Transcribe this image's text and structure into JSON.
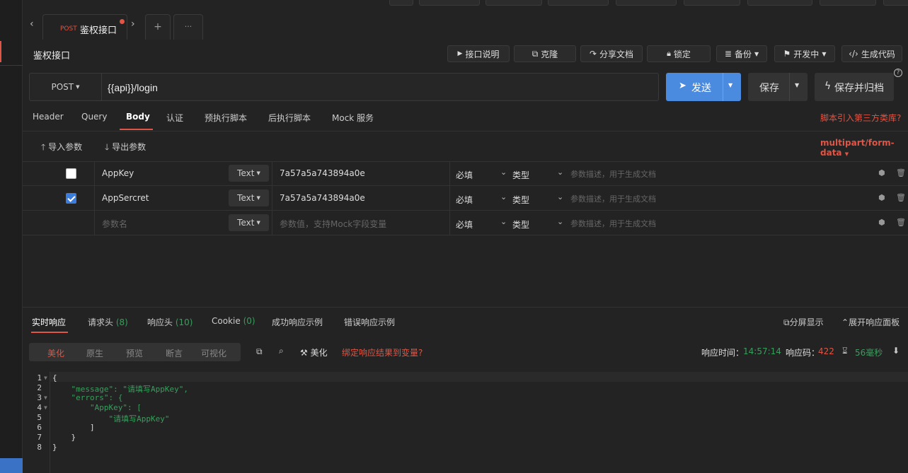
{
  "tab": {
    "method": "POST",
    "title": "鉴权接口",
    "add_label": "+",
    "more_label": "···"
  },
  "page": {
    "title": "鉴权接口"
  },
  "toolbar": {
    "doc_label": "接口说明",
    "clone_label": "克隆",
    "share_label": "分享文档",
    "lock_label": "锁定",
    "backup_label": "备份",
    "status_label": "开发中",
    "codegen_label": "生成代码"
  },
  "request": {
    "method": "POST",
    "url": "{{api}}/login",
    "send_label": "发送",
    "save_label": "保存",
    "save_archive_label": "保存并归档"
  },
  "subtabs": [
    "Header",
    "Query",
    "Body",
    "认证",
    "预执行脚本",
    "后执行脚本",
    "Mock 服务"
  ],
  "script_link": "脚本引入第三方类库?",
  "body": {
    "import_label": "导入参数",
    "export_label": "导出参数",
    "content_type": "multipart/form-data",
    "rows": [
      {
        "checked": false,
        "name": "AppKey",
        "type": "Text",
        "value": "7a57a5a743894a0e",
        "required": "必填",
        "field_type": "类型",
        "desc": "参数描述，用于生成文档"
      },
      {
        "checked": true,
        "name": "AppSercret",
        "type": "Text",
        "value": "7a57a5a743894a0e",
        "required": "必填",
        "field_type": "类型",
        "desc": "参数描述，用于生成文档"
      }
    ],
    "new_row": {
      "name_placeholder": "参数名",
      "type": "Text",
      "value_placeholder": "参数值，支持Mock字段变量",
      "required": "必填",
      "field_type": "类型",
      "desc": "参数描述，用于生成文档"
    }
  },
  "response_tabs": {
    "realtime": "实时响应",
    "req_headers": "请求头",
    "req_headers_count": "(8)",
    "resp_headers": "响应头",
    "resp_headers_count": "(10)",
    "cookie": "Cookie",
    "cookie_count": "(0)",
    "success_example": "成功响应示例",
    "error_example": "错误响应示例",
    "split_label": "分屏显示",
    "expand_label": "展开响应面板"
  },
  "response_toolbar": {
    "formats": [
      "美化",
      "原生",
      "预览",
      "断言",
      "可视化"
    ],
    "beautify_label": "美化",
    "bind_label": "绑定响应结果到变量?",
    "time_label": "响应时间：",
    "time_value": "14:57:14",
    "code_label": "响应码：",
    "code_value": "422",
    "duration_value": "56毫秒"
  },
  "response_body": {
    "line_numbers": [
      "1",
      "2",
      "3",
      "4",
      "5",
      "6",
      "7",
      "8"
    ],
    "lines": [
      "{",
      "    \"message\": \"请填写AppKey\",",
      "    \"errors\": {",
      "        \"AppKey\": [",
      "            \"请填写AppKey\"",
      "        ]",
      "    }",
      "}"
    ]
  },
  "colors": {
    "accent": "#e05545",
    "primary": "#4a8be0",
    "success": "#3a9d5d"
  }
}
